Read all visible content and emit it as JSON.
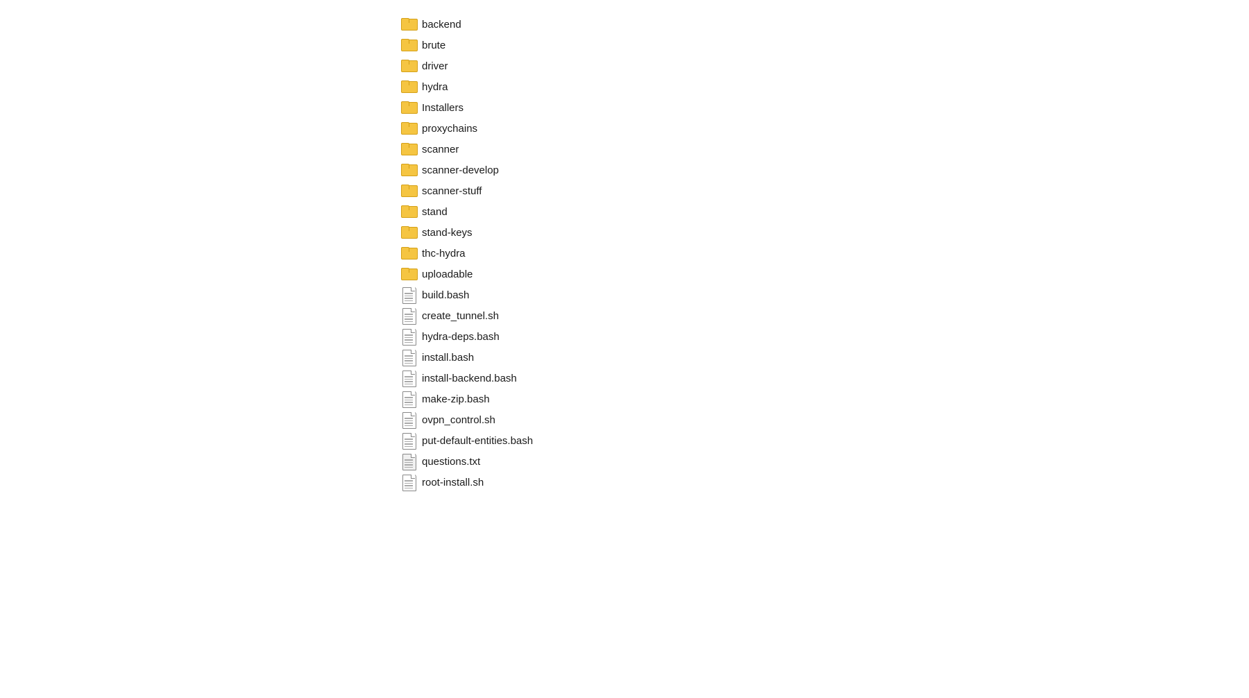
{
  "fileList": {
    "items": [
      {
        "id": "backend",
        "name": "backend",
        "type": "folder"
      },
      {
        "id": "brute",
        "name": "brute",
        "type": "folder"
      },
      {
        "id": "driver",
        "name": "driver",
        "type": "folder"
      },
      {
        "id": "hydra",
        "name": "hydra",
        "type": "folder"
      },
      {
        "id": "installers",
        "name": "Installers",
        "type": "folder"
      },
      {
        "id": "proxychains",
        "name": "proxychains",
        "type": "folder"
      },
      {
        "id": "scanner",
        "name": "scanner",
        "type": "folder"
      },
      {
        "id": "scanner-develop",
        "name": "scanner-develop",
        "type": "folder"
      },
      {
        "id": "scanner-stuff",
        "name": "scanner-stuff",
        "type": "folder"
      },
      {
        "id": "stand",
        "name": "stand",
        "type": "folder"
      },
      {
        "id": "stand-keys",
        "name": "stand-keys",
        "type": "folder"
      },
      {
        "id": "thc-hydra",
        "name": "thc-hydra",
        "type": "folder"
      },
      {
        "id": "uploadable",
        "name": "uploadable",
        "type": "folder"
      },
      {
        "id": "build-bash",
        "name": "build.bash",
        "type": "file"
      },
      {
        "id": "create-tunnel-sh",
        "name": "create_tunnel.sh",
        "type": "file"
      },
      {
        "id": "hydra-deps-bash",
        "name": "hydra-deps.bash",
        "type": "file"
      },
      {
        "id": "install-bash",
        "name": "install.bash",
        "type": "file"
      },
      {
        "id": "install-backend-bash",
        "name": "install-backend.bash",
        "type": "file"
      },
      {
        "id": "make-zip-bash",
        "name": "make-zip.bash",
        "type": "file"
      },
      {
        "id": "ovpn-control-sh",
        "name": "ovpn_control.sh",
        "type": "file"
      },
      {
        "id": "put-default-entities-bash",
        "name": "put-default-entities.bash",
        "type": "file"
      },
      {
        "id": "questions-txt",
        "name": "questions.txt",
        "type": "file-striped"
      },
      {
        "id": "root-install-sh",
        "name": "root-install.sh",
        "type": "file"
      }
    ]
  }
}
